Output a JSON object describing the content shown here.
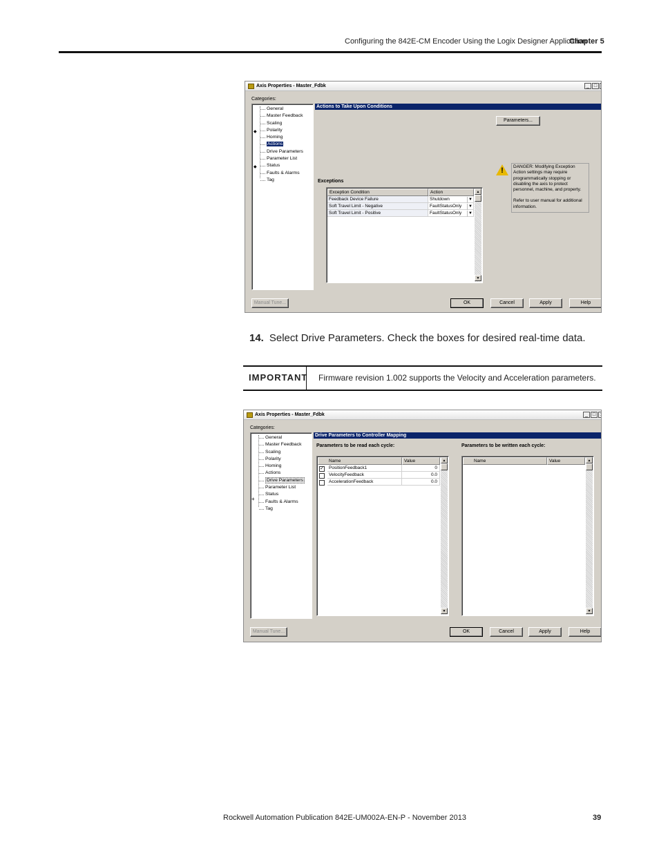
{
  "header": {
    "title": "Configuring the 842E-CM Encoder Using the Logix Designer Application",
    "chapter": "Chapter 5"
  },
  "dialog1": {
    "title": "Axis Properties - Master_Fdbk",
    "window_buttons": [
      "_",
      "□",
      "x"
    ],
    "categories_label": "Categories:",
    "categories": [
      "General",
      "Master Feedback",
      "Scaling",
      "Polarity",
      "Homing",
      "Actions",
      "Drive Parameters",
      "Parameter List",
      "Status",
      "Faults & Alarms",
      "Tag"
    ],
    "selected_category": "Actions",
    "panel_title": "Actions to Take Upon Conditions",
    "parameters_button": "Parameters...",
    "exceptions_label": "Exceptions",
    "table_headers": [
      "Exception Condition",
      "Action"
    ],
    "rows": [
      {
        "condition": "Feedback Device Failure",
        "action": "Shutdown"
      },
      {
        "condition": "Soft Travel Limit - Negative",
        "action": "FaultStatusOnly"
      },
      {
        "condition": "Soft Travel Limit - Positive",
        "action": "FaultStatusOnly"
      }
    ],
    "danger_lines": [
      "DANGER: Modifying Exception",
      "Action settings may require",
      "programmatically stopping or",
      "disabling the axis to protect",
      "personnel, machine, and property.",
      "",
      "Refer to user manual for additional",
      "information."
    ],
    "buttons": {
      "manual_tune": "Manual Tune...",
      "ok": "OK",
      "cancel": "Cancel",
      "apply": "Apply",
      "help": "Help"
    }
  },
  "step": {
    "number": "14.",
    "text": "Select Drive Parameters. Check the boxes for desired real-time data."
  },
  "important": {
    "label": "IMPORTANT",
    "text": "Firmware revision 1.002 supports the Velocity and Acceleration parameters."
  },
  "dialog2": {
    "title": "Axis Properties - Master_Fdbk",
    "window_buttons": [
      "_",
      "□",
      "x"
    ],
    "categories_label": "Categories:",
    "categories": [
      "General",
      "Master Feedback",
      "Scaling",
      "Polarity",
      "Homing",
      "Actions",
      "Drive Parameters",
      "Parameter List",
      "Status",
      "Faults & Alarms",
      "Tag"
    ],
    "selected_category": "Drive Parameters",
    "panel_title": "Drive Parameters to Controller Mapping",
    "read_label": "Parameters to be read each cycle:",
    "write_label": "Parameters to be written each cycle:",
    "table_headers": [
      "Name",
      "Value"
    ],
    "read_rows": [
      {
        "checked": true,
        "name": "PositionFeedback1",
        "value": "0"
      },
      {
        "checked": false,
        "name": "VelocityFeedback",
        "value": "0.0"
      },
      {
        "checked": false,
        "name": "AccelerationFeedback",
        "value": "0.0"
      }
    ],
    "check_mark": "✓",
    "buttons": {
      "manual_tune": "Manual Tune...",
      "ok": "OK",
      "cancel": "Cancel",
      "apply": "Apply",
      "help": "Help"
    }
  },
  "footer": {
    "publication": "Rockwell Automation Publication 842E-UM002A-EN-P - November 2013",
    "page_number": "39"
  },
  "colors": {
    "selection": "#0a246a",
    "dialog_bg": "#d4d0c8",
    "warning": "#e8b800"
  },
  "icons": {
    "warning": "warning-triangle-icon",
    "expander": "plus-icon",
    "scroll_up": "arrow-up-icon",
    "scroll_down": "arrow-down-icon"
  }
}
